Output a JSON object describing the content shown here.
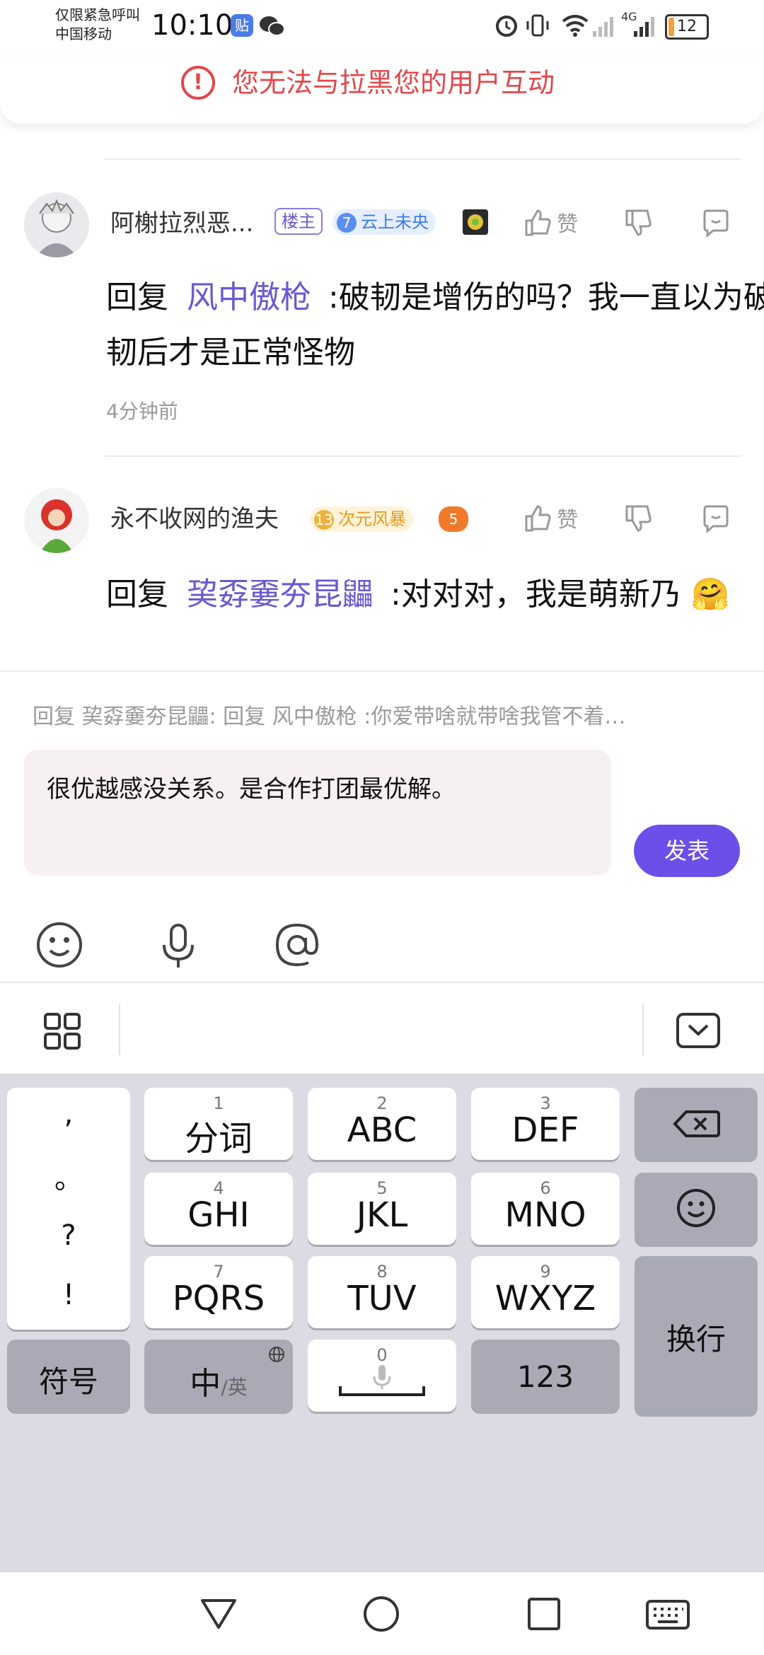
{
  "status_bar": {
    "carrier_line1": "仅限紧急呼叫",
    "carrier_line2": "中国移动",
    "time": "10:10",
    "network": "4G",
    "battery": "12"
  },
  "toast": {
    "message": "您无法与拉黑您的用户互动"
  },
  "comments": [
    {
      "username": "阿榭拉烈恶...",
      "owner_tag": "楼主",
      "level": "7",
      "badge": "云上未央",
      "like_label": "赞",
      "reply_prefix": "回复",
      "mention": "风中傲枪",
      "text": ":破韧是增伤的吗？我一直以为破韧后才是正常怪物",
      "time": "4分钟前"
    },
    {
      "username": "永不收网的渔夫",
      "level": "13",
      "badge": "次元风暴",
      "extra_badge": "5",
      "like_label": "赞",
      "reply_prefix": "回复",
      "mention": "巭孬嫑夯昆鼺",
      "text": ":对对对，我是萌新乃",
      "emoji": "🤗"
    }
  ],
  "reply": {
    "quote": "回复 巭孬嫑夯昆鼺: 回复 风中傲枪 :你爱带啥就带啥我管不着…",
    "input_value": "很优越感没关系。是合作打团最优解。",
    "send_label": "发表"
  },
  "keyboard": {
    "punct": [
      ",",
      "。",
      "?",
      "!"
    ],
    "keys": [
      {
        "num": "1",
        "label": "分词"
      },
      {
        "num": "2",
        "label": "ABC"
      },
      {
        "num": "3",
        "label": "DEF"
      },
      {
        "num": "4",
        "label": "GHI"
      },
      {
        "num": "5",
        "label": "JKL"
      },
      {
        "num": "6",
        "label": "MNO"
      },
      {
        "num": "7",
        "label": "PQRS"
      },
      {
        "num": "8",
        "label": "TUV"
      },
      {
        "num": "9",
        "label": "WXYZ"
      }
    ],
    "symbols_label": "符号",
    "lang_main": "中",
    "lang_alt": "/英",
    "space_num": "0",
    "num_label": "123",
    "enter_label": "换行"
  },
  "colors": {
    "accent": "#6b4fe8",
    "mention": "#6b58d4",
    "warning": "#e2474b"
  }
}
